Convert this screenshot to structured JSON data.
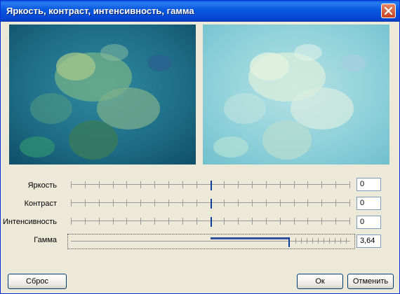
{
  "window": {
    "title": "Яркость, контраст, интенсивность, гамма"
  },
  "sliders": [
    {
      "label": "Яркость",
      "value": "0",
      "position": 0.5
    },
    {
      "label": "Контраст",
      "value": "0",
      "position": 0.5
    },
    {
      "label": "Интенсивность",
      "value": "0",
      "position": 0.5
    },
    {
      "label": "Гамма",
      "value": "3,64",
      "position": 0.78
    }
  ],
  "buttons": {
    "reset": "Сброс",
    "ok": "Ок",
    "cancel": "Отменить"
  },
  "icons": {
    "close": "close-icon"
  },
  "colors": {
    "titlebar": "#0a5ae0",
    "close": "#d9532f",
    "slider_thumb": "#0a3f9c"
  }
}
